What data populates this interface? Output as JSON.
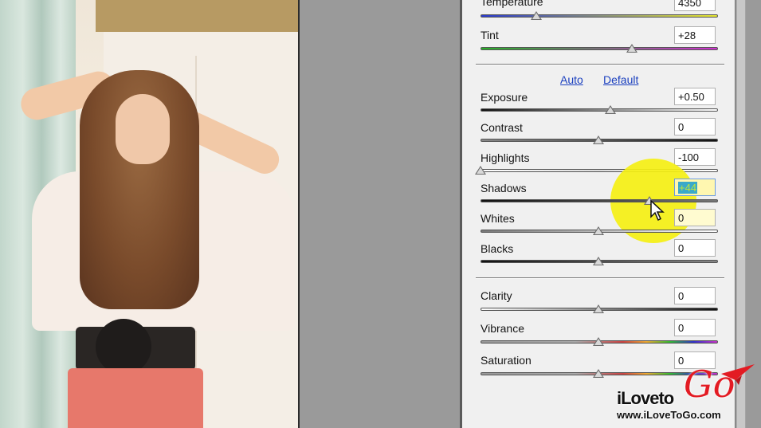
{
  "photo": {
    "alt": "Portrait photo being edited"
  },
  "panel": {
    "temperature": {
      "label": "Temperature",
      "value": "4350",
      "position": 0.25
    },
    "tint": {
      "label": "Tint",
      "value": "+28",
      "position": 0.64
    },
    "auto_link": "Auto",
    "default_link": "Default",
    "sliders": [
      {
        "label": "Exposure",
        "value": "+0.50",
        "position": 0.55
      },
      {
        "label": "Contrast",
        "value": "0",
        "position": 0.5
      },
      {
        "label": "Highlights",
        "value": "-100",
        "position": 0.0
      },
      {
        "label": "Shadows",
        "value": "+44",
        "position": 0.72
      },
      {
        "label": "Whites",
        "value": "0",
        "position": 0.5
      },
      {
        "label": "Blacks",
        "value": "0",
        "position": 0.5
      }
    ],
    "presence": [
      {
        "label": "Clarity",
        "value": "0",
        "position": 0.5
      },
      {
        "label": "Vibrance",
        "value": "0",
        "position": 0.5
      },
      {
        "label": "Saturation",
        "value": "0",
        "position": 0.5
      }
    ]
  },
  "watermark": {
    "brand_left": "iLoveto",
    "brand_go": "Go",
    "url": "www.iLoveToGo.com"
  },
  "colors": {
    "accent_link": "#1a3fbf",
    "highlight": "#f5f014",
    "logo_red": "#e31b23"
  }
}
